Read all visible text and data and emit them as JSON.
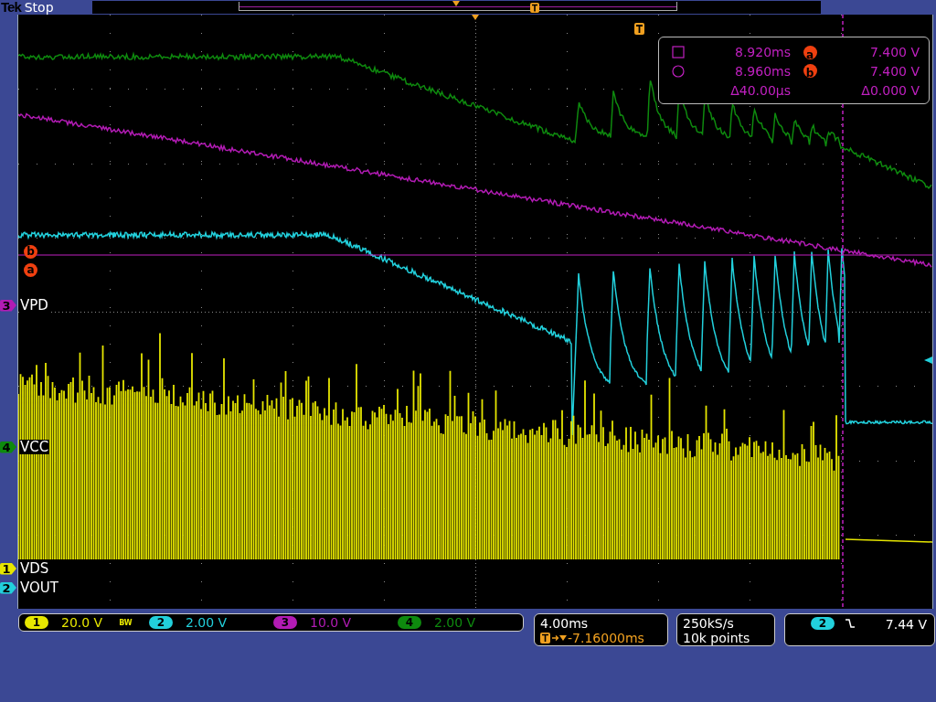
{
  "top_bar": {
    "brand": "Tek",
    "acquisition_state": "Stop"
  },
  "channel_labels": [
    {
      "number": "3",
      "name": "VPD",
      "color": "#b21bb4"
    },
    {
      "number": "4",
      "name": "VCC",
      "color": "#0e8a0e"
    },
    {
      "number": "1",
      "name": "VDS",
      "color": "#e6e600"
    },
    {
      "number": "2",
      "name": "VOUT",
      "color": "#22d0dc"
    }
  ],
  "cursor_markers": [
    {
      "label": "b"
    },
    {
      "label": "a"
    }
  ],
  "cursor_readout": {
    "rows": [
      {
        "kind": "square",
        "time": "8.920ms",
        "marker": "a",
        "value": "7.400 V"
      },
      {
        "kind": "circle",
        "time": "8.960ms",
        "marker": "b",
        "value": "7.400 V"
      },
      {
        "kind": "delta",
        "time": "Δ40.00µs",
        "value": "Δ0.000 V"
      }
    ]
  },
  "channels": [
    {
      "number": "1",
      "scale": "20.0 V",
      "color": "#e6e600",
      "bandwidth_limit": "BW"
    },
    {
      "number": "2",
      "scale": "2.00 V",
      "color": "#22d0dc"
    },
    {
      "number": "3",
      "scale": "10.0 V",
      "color": "#b21bb4"
    },
    {
      "number": "4",
      "scale": "2.00 V",
      "color": "#0e8a0e"
    }
  ],
  "timebase": {
    "scale": "4.00ms",
    "trigger_position": "-7.16000ms"
  },
  "acquisition": {
    "sample_rate": "250kS/s",
    "record_length": "10k points"
  },
  "trigger": {
    "source": "2",
    "color": "#22d0dc",
    "level": "7.44 V"
  }
}
